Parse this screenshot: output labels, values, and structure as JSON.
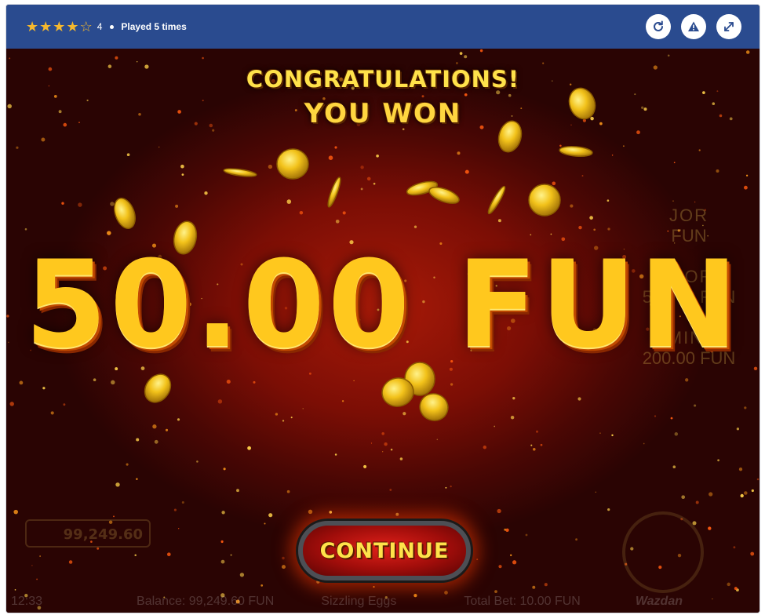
{
  "topbar": {
    "rating": {
      "value": "4",
      "filled_stars": 4,
      "total_stars": 5
    },
    "played": "Played 5 times",
    "actions": [
      {
        "icon": "refresh-icon"
      },
      {
        "icon": "report-icon"
      },
      {
        "icon": "fullscreen-icon"
      }
    ]
  },
  "game": {
    "headline": "CONGRATULATIONS!",
    "subheadline": "YOU WON",
    "win_amount": "50.00 FUN",
    "continue_label": "CONTINUE",
    "background_ui": {
      "balance_box": "99,249.60",
      "clock": "12:33",
      "balance": "Balance: 99,249.60 FUN",
      "game_name": "Sizzling Eggs",
      "total_bet": "Total Bet: 10.00 FUN",
      "provider": "Wazdan",
      "jackpots": [
        {
          "label": "JOR",
          "value": "FUN"
        },
        {
          "label": "INOR",
          "value": "500.00 FUN"
        },
        {
          "label": "MINI",
          "value": "200.00 FUN"
        }
      ]
    }
  },
  "colors": {
    "topbar": "#2a4b8f",
    "star": "#f5b82e",
    "gold_text": "#ffc81e",
    "button_red": "#c0150f"
  }
}
